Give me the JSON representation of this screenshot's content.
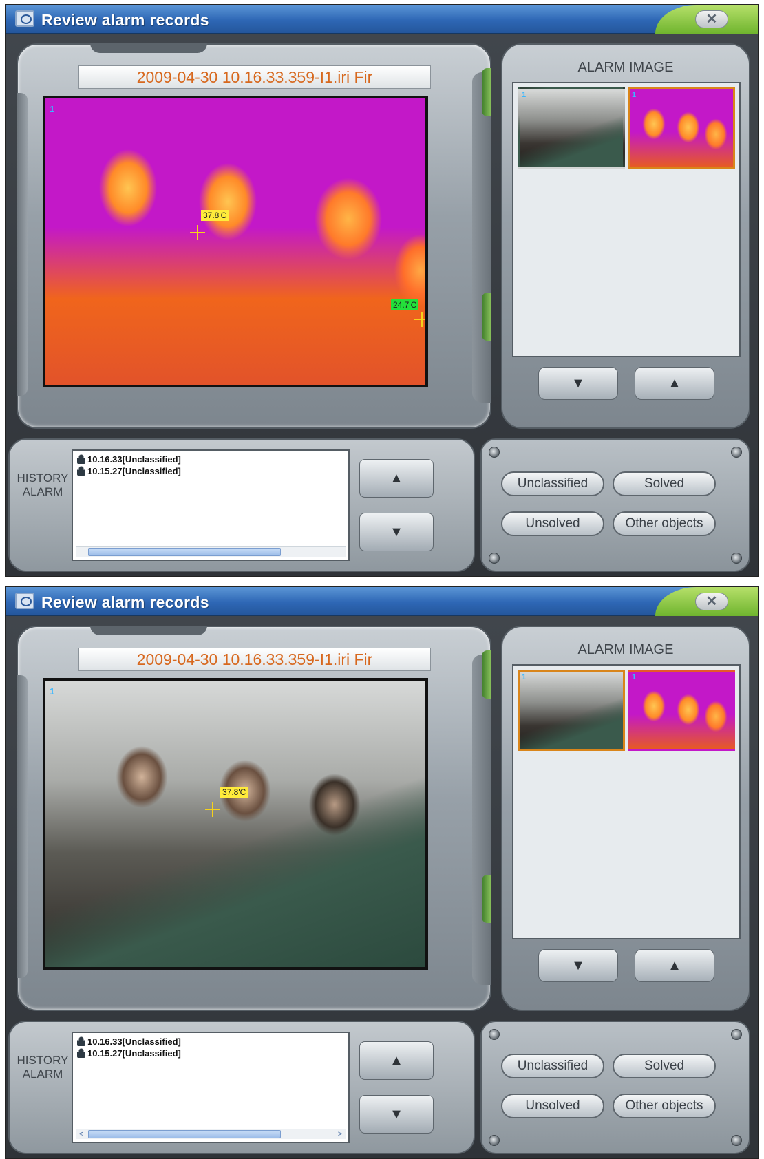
{
  "windows": [
    {
      "title": "Review alarm records",
      "close_label": "✕",
      "viewer": {
        "filename": "2009-04-30 10.16.33.359-I1.iri Fir",
        "channel": "1",
        "mode": "thermal",
        "temps": [
          "37.8'C",
          "24.7'C"
        ]
      },
      "alarm_image": {
        "title": "ALARM IMAGE",
        "thumb_channel_1": "1",
        "thumb_channel_2": "1",
        "selected": "thermal"
      },
      "history": {
        "label": "HISTORY\nALARM",
        "rows": [
          "10.16.33[Unclassified]",
          "10.15.27[Unclassified]"
        ]
      },
      "buttons": {
        "down": "▼",
        "up": "▲",
        "unclassified": "Unclassified",
        "solved": "Solved",
        "unsolved": "Unsolved",
        "other": "Other objects"
      }
    },
    {
      "title": "Review alarm records",
      "close_label": "✕",
      "viewer": {
        "filename": "2009-04-30 10.16.33.359-I1.iri Fir",
        "channel": "1",
        "mode": "visible",
        "temps": [
          "37.8'C"
        ]
      },
      "alarm_image": {
        "title": "ALARM IMAGE",
        "thumb_channel_1": "1",
        "thumb_channel_2": "1",
        "selected": "visible"
      },
      "history": {
        "label": "HISTORY\nALARM",
        "rows": [
          "10.16.33[Unclassified]",
          "10.15.27[Unclassified]"
        ]
      },
      "buttons": {
        "down": "▼",
        "up": "▲",
        "unclassified": "Unclassified",
        "solved": "Solved",
        "unsolved": "Unsolved",
        "other": "Other objects",
        "scroll_left": "<",
        "scroll_right": ">"
      }
    }
  ],
  "colors": {
    "filename": "#d7681e",
    "selection_border": "#d9851a",
    "channel_label": "#39b7ff",
    "temp_yellow": "#ffeb3b",
    "temp_green": "#23e03a"
  },
  "icons": {
    "window": "camera-window-icon",
    "close": "close-icon",
    "alarm_row": "person-alarm-icon"
  }
}
